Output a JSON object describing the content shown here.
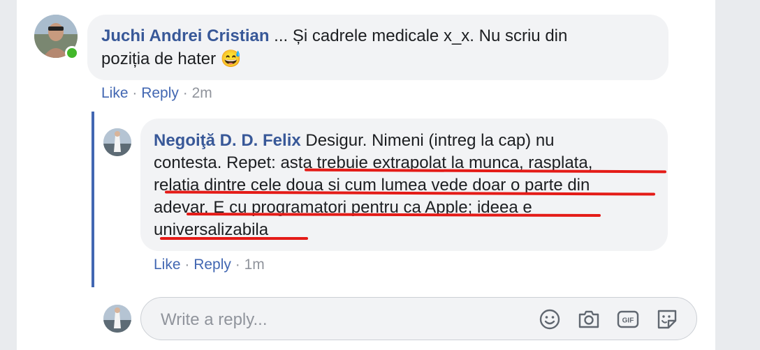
{
  "comment": {
    "author": "Juchi Andrei Cristian",
    "text_line1": " ... Și cadrele medicale x_x. Nu scriu din",
    "text_line2": "poziția de hater",
    "emoji": "😅",
    "like": "Like",
    "sep1": " · ",
    "reply": "Reply",
    "sep2": " · ",
    "time": "2m"
  },
  "reply_comment": {
    "author": "Negoiţă D. D. Felix",
    "line1": " Desigur. Nimeni (intreg la cap) nu",
    "line2": "contesta. Repet: asta trebuie extrapolat la munca, rasplata,",
    "line3": "relatia dintre cele doua si cum lumea vede doar o parte din",
    "line4": "adevar. E cu programatori pentru ca Apple; ideea e",
    "line5": "universalizabila",
    "like": "Like",
    "sep1": " · ",
    "reply": "Reply",
    "sep2": " · ",
    "time": "1m"
  },
  "composer": {
    "placeholder": "Write a reply...",
    "icons": [
      "emoji-icon",
      "camera-icon",
      "gif-icon",
      "sticker-icon"
    ]
  },
  "colors": {
    "link": "#385898",
    "action": "#4267b2",
    "annotation": "#e41b17",
    "online": "#42b72a"
  }
}
